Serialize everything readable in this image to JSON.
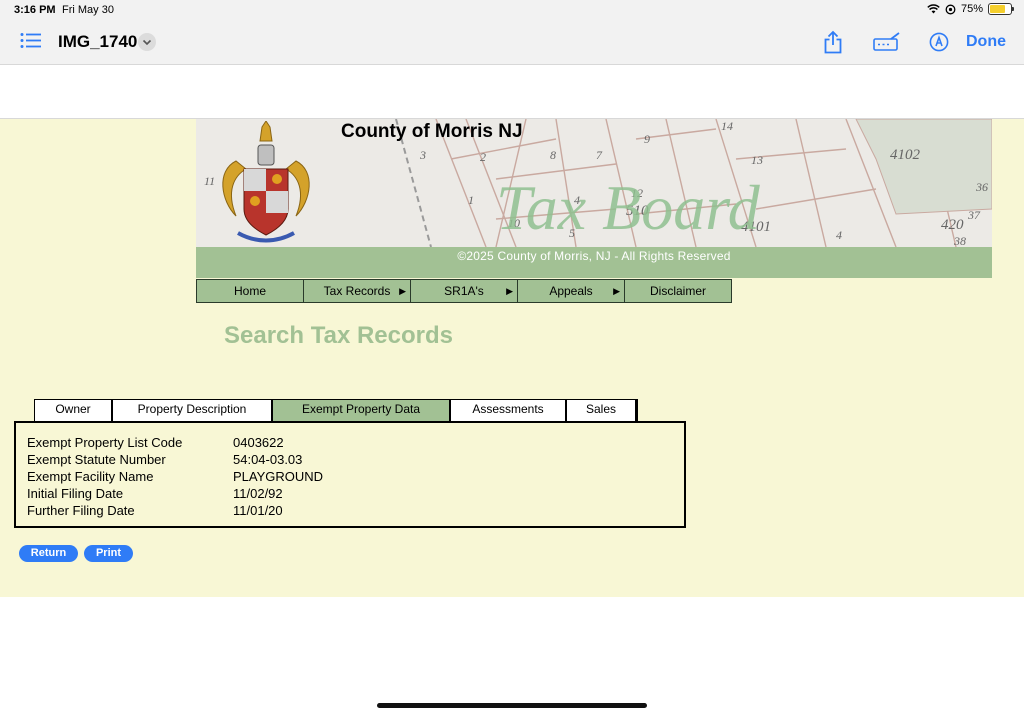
{
  "status_bar": {
    "time": "3:16 PM",
    "date": "Fri May 30",
    "battery": "75%",
    "battery_level": 0.75
  },
  "toolbar": {
    "document_title": "IMG_1740",
    "done_label": "Done",
    "icons": [
      "list-icon",
      "chevron-down-icon",
      "share-icon",
      "markup-icon",
      "pen-icon"
    ]
  },
  "banner": {
    "title": "County of Morris NJ",
    "script_title": "Tax Board",
    "copyright": "©2025 County of Morris, NJ - All Rights Reserved",
    "map_labels": [
      "14",
      "9",
      "3",
      "2",
      "8",
      "7",
      "1",
      "4",
      "11",
      "10",
      "13",
      "12",
      "510",
      "5",
      "4101",
      "4102",
      "36",
      "37",
      "38",
      "420",
      "4"
    ]
  },
  "nav": {
    "items": [
      {
        "label": "Home",
        "has_arrow": false
      },
      {
        "label": "Tax Records",
        "has_arrow": true
      },
      {
        "label": "SR1A's",
        "has_arrow": true
      },
      {
        "label": "Appeals",
        "has_arrow": true
      },
      {
        "label": "Disclaimer",
        "has_arrow": false
      }
    ]
  },
  "page_heading": "Search Tax Records",
  "tabs": [
    {
      "label": "Owner",
      "active": false
    },
    {
      "label": "Property Description",
      "active": false
    },
    {
      "label": "Exempt Property Data",
      "active": true
    },
    {
      "label": "Assessments",
      "active": false
    },
    {
      "label": "Sales",
      "active": false
    }
  ],
  "record": [
    {
      "label": "Exempt Property List Code",
      "value": "0403622"
    },
    {
      "label": "Exempt Statute Number",
      "value": "54:04-03.03"
    },
    {
      "label": "Exempt Facility Name",
      "value": "PLAYGROUND"
    },
    {
      "label": "Initial Filing Date",
      "value": "11/02/92"
    },
    {
      "label": "Further Filing Date",
      "value": "11/01/20"
    }
  ],
  "buttons": {
    "return_label": "Return",
    "print_label": "Print"
  },
  "colors": {
    "accent_green": "#a2c194",
    "page_bg": "#f8f7d5",
    "ios_blue": "#2f7cf6"
  }
}
